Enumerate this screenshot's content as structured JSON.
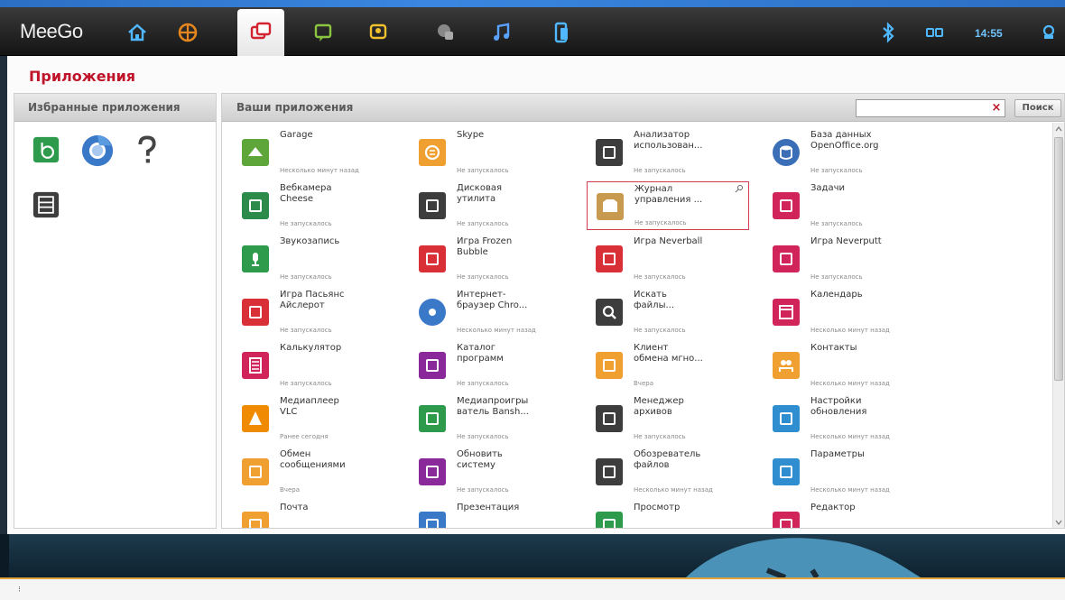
{
  "taskbar": {
    "logo": "MeeGo",
    "icons": [
      "home-icon",
      "zones-icon",
      "applications-icon",
      "status-icon",
      "people-icon",
      "internet-icon",
      "music-icon",
      "devices-icon"
    ],
    "active": "applications-icon",
    "time": "14:55"
  },
  "panel": {
    "title": "Приложения",
    "favorites_header": "Избранные приложения",
    "favorites": [
      "banshee-icon",
      "chromium-icon",
      "help-icon",
      "file-manager-icon"
    ],
    "apps_header": "Ваши приложения",
    "search": {
      "value": "",
      "button_label": "Поиск"
    }
  },
  "apps": [
    {
      "name": "Garage",
      "status": "Несколько минут назад",
      "icon": "garage-icon",
      "color": "#5fa63a"
    },
    {
      "name": "Skype",
      "status": "Не запускалось",
      "icon": "skype-icon",
      "color": "#f0a030"
    },
    {
      "name": "Анализатор\nиспользован...",
      "status": "Не запускалось",
      "icon": "disk-analyzer-icon",
      "color": "#3d3d3d"
    },
    {
      "name": "База данных\nOpenOffice.org",
      "status": "Не запускалось",
      "icon": "database-icon",
      "color": "#3a6fb8"
    },
    {
      "name": "Вебкамера\nCheese",
      "status": "Не запускалось",
      "icon": "webcam-icon",
      "color": "#2c8a4a"
    },
    {
      "name": "Дисковая\nутилита",
      "status": "Не запускалось",
      "icon": "disk-utility-icon",
      "color": "#3d3d3d"
    },
    {
      "name": "Журнал\nуправления ...",
      "status": "Не запускалось",
      "icon": "package-log-icon",
      "color": "#c89a50"
    },
    {
      "name": "Задачи",
      "status": "Не запускалось",
      "icon": "tasks-icon",
      "color": "#d0245a"
    },
    {
      "name": "Звукозапись",
      "status": "Не запускалось",
      "icon": "sound-recorder-icon",
      "color": "#2e9a4c"
    },
    {
      "name": "Игра Frozen\nBubble",
      "status": "Не запускалось",
      "icon": "frozen-bubble-icon",
      "color": "#d93038"
    },
    {
      "name": "Игра Neverball",
      "status": "Не запускалось",
      "icon": "neverball-icon",
      "color": "#d93038"
    },
    {
      "name": "Игра Neverputt",
      "status": "Не запускалось",
      "icon": "neverputt-icon",
      "color": "#d0245a"
    },
    {
      "name": "Игра Пасьянс\nAйслерот",
      "status": "Не запускалось",
      "icon": "solitaire-icon",
      "color": "#d93038"
    },
    {
      "name": "Интернет-\nбраузер Chro...",
      "status": "Несколько минут назад",
      "icon": "chromium-icon",
      "color": "#3a78c8"
    },
    {
      "name": "Искать\nфайлы...",
      "status": "Не запускалось",
      "icon": "search-files-icon",
      "color": "#3d3d3d"
    },
    {
      "name": "Календарь",
      "status": "Несколько минут назад",
      "icon": "calendar-icon",
      "color": "#d0245a"
    },
    {
      "name": "Калькулятор",
      "status": "Не запускалось",
      "icon": "calculator-icon",
      "color": "#d0245a"
    },
    {
      "name": "Каталог\nпрограмм",
      "status": "Не запускалось",
      "icon": "app-catalog-icon",
      "color": "#8a2a9a"
    },
    {
      "name": "Клиент\nобмена мгно...",
      "status": "Вчера",
      "icon": "im-client-icon",
      "color": "#f0a030"
    },
    {
      "name": "Контакты",
      "status": "Несколько минут назад",
      "icon": "contacts-icon",
      "color": "#f0a030"
    },
    {
      "name": "Медиаплеер\nVLC",
      "status": "Ранее сегодня",
      "icon": "vlc-icon",
      "color": "#f08a00"
    },
    {
      "name": "Медиапроигры\nватель Bansh...",
      "status": "Не запускалось",
      "icon": "banshee-icon",
      "color": "#2e9a4c"
    },
    {
      "name": "Менеджер\nархивов",
      "status": "Не запускалось",
      "icon": "archive-manager-icon",
      "color": "#3d3d3d"
    },
    {
      "name": "Настройки\nобновления",
      "status": "Несколько минут назад",
      "icon": "update-settings-icon",
      "color": "#2e8ed0"
    },
    {
      "name": "Обмен\nсообщениями",
      "status": "Вчера",
      "icon": "messaging-icon",
      "color": "#f0a030"
    },
    {
      "name": "Обновить\nсистему",
      "status": "Не запускалось",
      "icon": "system-update-icon",
      "color": "#8a2a9a"
    },
    {
      "name": "Обозреватель\nфайлов",
      "status": "Несколько минут назад",
      "icon": "file-browser-icon",
      "color": "#3d3d3d"
    },
    {
      "name": "Параметры",
      "status": "Несколько минут назад",
      "icon": "settings-icon",
      "color": "#2e8ed0"
    },
    {
      "name": "Почта",
      "status": "",
      "icon": "mail-icon",
      "color": "#f0a030"
    },
    {
      "name": "Презентация",
      "status": "",
      "icon": "presentation-icon",
      "color": "#3a78c8"
    },
    {
      "name": "Просмотр",
      "status": "",
      "icon": "viewer-icon",
      "color": "#2e9a4c"
    },
    {
      "name": "Редактор",
      "status": "",
      "icon": "editor-icon",
      "color": "#d0245a"
    }
  ],
  "selected_app": "Журнал\nуправления ..."
}
